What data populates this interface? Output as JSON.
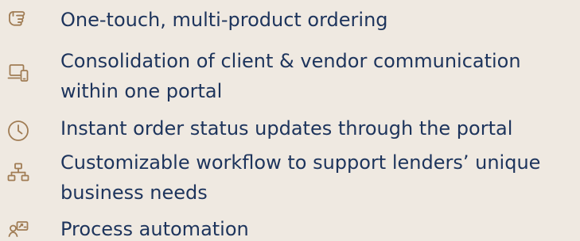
{
  "colors": {
    "background": "#efe9e1",
    "text": "#1d345c",
    "icon": "#a07c54"
  },
  "features": [
    {
      "icon": "pointing-hand-icon",
      "text": "One-touch, multi-product ordering"
    },
    {
      "icon": "devices-icon",
      "text": "Consolidation of client & vendor communication within one portal"
    },
    {
      "icon": "clock-icon",
      "text": "Instant order status updates through the portal"
    },
    {
      "icon": "workflow-icon",
      "text": "Customizable workflow to support lenders’ unique business needs"
    },
    {
      "icon": "automation-icon",
      "text": "Process automation"
    }
  ]
}
